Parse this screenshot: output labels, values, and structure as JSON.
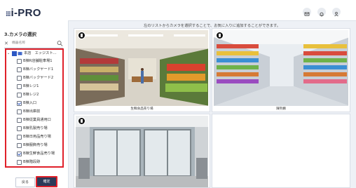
{
  "app": {
    "logo_text": "i-PRO",
    "logo_dots": "⁝⁝⁝"
  },
  "sidebar": {
    "step_title": "3.カメラの選択",
    "search": {
      "placeholder": "機器名称"
    },
    "tree": {
      "root_label": "本店　エッジスト…",
      "items": [
        {
          "label": "B棟R店舗駐車場1",
          "checked": false
        },
        {
          "label": "B棟バックヤード1",
          "checked": false
        },
        {
          "label": "B棟バックヤード2",
          "checked": false
        },
        {
          "label": "B棟レジ1",
          "checked": false
        },
        {
          "label": "B棟レジ2",
          "checked": false
        },
        {
          "label": "B棟入口",
          "checked": true
        },
        {
          "label": "B棟出庫前",
          "checked": false
        },
        {
          "label": "B棟従業員通用口",
          "checked": false
        },
        {
          "label": "B棟乳製売り場",
          "checked": false
        },
        {
          "label": "B棟日用品売り場",
          "checked": false
        },
        {
          "label": "B棟服飾売り場",
          "checked": false
        },
        {
          "label": "B棟生鮮食品売り場",
          "checked": true
        },
        {
          "label": "B棟階段跡",
          "checked": false
        }
      ]
    },
    "back_label": "戻る",
    "confirm_label": "確定"
  },
  "header": {
    "icons": [
      "mail-icon",
      "bell-icon",
      "user-icon"
    ]
  },
  "main": {
    "hint": "左のリストからカメラを選択することで、お気に入りに追加することができます。",
    "tiles": [
      {
        "caption": "生鮮食品売り場"
      },
      {
        "caption": "陳列棚"
      },
      {
        "caption": ""
      },
      {
        "caption": ""
      }
    ]
  },
  "colors": {
    "accent": "#e0202a",
    "brand": "#2b3a58",
    "check": "#2c57c4"
  }
}
